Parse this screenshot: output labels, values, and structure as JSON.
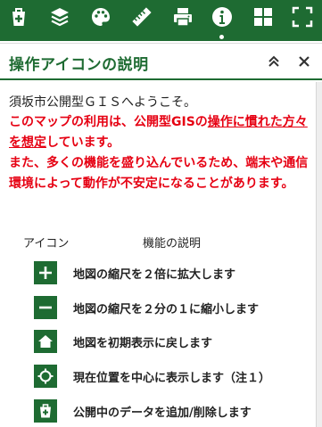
{
  "toolbar": {
    "buttons": [
      {
        "name": "layer-add-icon"
      },
      {
        "name": "layers-icon"
      },
      {
        "name": "palette-icon"
      },
      {
        "name": "ruler-icon"
      },
      {
        "name": "print-icon"
      },
      {
        "name": "info-icon",
        "active": true
      },
      {
        "name": "grid-icon"
      },
      {
        "name": "fullscreen-icon"
      }
    ]
  },
  "panel": {
    "title": "操作アイコンの説明",
    "collapse_icon": "double-chevron-up-icon",
    "close_icon": "close-icon"
  },
  "intro": {
    "welcome": "須坂市公開型ＧＩＳへようこそ。",
    "notice_1_pre": "このマップの利用は、公開型GISの",
    "notice_1_link": "操作に慣れた方々を想定",
    "notice_1_post": "しています。",
    "notice_2": "また、多くの機能を盛り込んでいるため、端末や通信環境によって動作が不安定になることがあります。"
  },
  "icon_table": {
    "header_icon": "アイコン",
    "header_desc": "機能の説明",
    "rows": [
      {
        "icon": "zoom-in-icon",
        "text": "地図の縮尺を２倍に拡大します"
      },
      {
        "icon": "zoom-out-icon",
        "text": "地図の縮尺を２分の１に縮小します"
      },
      {
        "icon": "home-icon",
        "text": "地図を初期表示に戻します"
      },
      {
        "icon": "locate-icon",
        "text": "現在位置を中心に表示します（注１）"
      },
      {
        "icon": "layer-add-icon",
        "text": "公開中のデータを追加/削除します"
      }
    ]
  },
  "colors": {
    "primary": "#1e6b32",
    "notice": "#e60012"
  }
}
